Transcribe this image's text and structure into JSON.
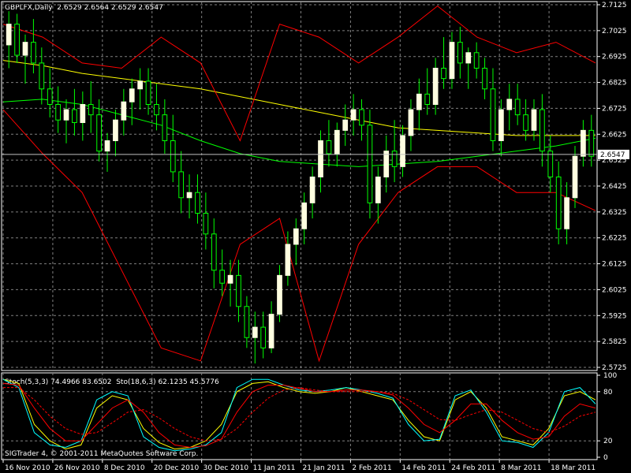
{
  "header": {
    "symbol_line": "GBPLFX,Daily  2.6529 2.6564 2.6529 2.6547",
    "stoch_line": "Stoch(5,3,3) 74.4966 83.6502  Sto(18,6,3) 62.1235 45.5776",
    "copyright": "SIGTrader 4, © 2001-2011 MetaQuotes Software Corp."
  },
  "colors": {
    "background": "#000000",
    "axis": "#ffffff",
    "grid": "#808080",
    "candle_bull": "#ffffe0",
    "candle_bear": "#00ff00",
    "ma_slow": "#ffff00",
    "ma_mid": "#00ff00",
    "bands": "#ff0000",
    "stoch_fast_main": "#ffff00",
    "stoch_slow_main": "#00ffff",
    "stoch_signal": "#ff0000",
    "price_tag_bg": "#ffffff",
    "price_tag_text": "#000000"
  },
  "chart_data": {
    "type": "candlestick",
    "symbol": "GBPLFX",
    "timeframe": "Daily",
    "current_price": "2.6547",
    "ylim": [
      2.5725,
      2.7125
    ],
    "y_tick_labels": [
      "2.7125",
      "2.7025",
      "2.6925",
      "2.6825",
      "2.6725",
      "2.6625",
      "2.6525",
      "2.6425",
      "2.6325",
      "2.6225",
      "2.6125",
      "2.6025",
      "2.5925",
      "2.5825",
      "2.5725"
    ],
    "x_tick_labels": [
      "16 Nov 2010",
      "26 Nov 2010",
      "8 Dec 2010",
      "20 Dec 2010",
      "30 Dec 2010",
      "11 Jan 2011",
      "21 Jan 2011",
      "2 Feb 2011",
      "14 Feb 2011",
      "24 Feb 2011",
      "8 Mar 2011",
      "18 Mar 2011"
    ],
    "candles": [
      [
        2.697,
        2.71,
        2.688,
        2.705
      ],
      [
        2.705,
        2.709,
        2.69,
        2.693
      ],
      [
        2.693,
        2.701,
        2.682,
        2.698
      ],
      [
        2.698,
        2.707,
        2.686,
        2.69
      ],
      [
        2.69,
        2.696,
        2.674,
        2.68
      ],
      [
        2.68,
        2.688,
        2.669,
        2.674
      ],
      [
        2.674,
        2.681,
        2.663,
        2.668
      ],
      [
        2.668,
        2.676,
        2.659,
        2.672
      ],
      [
        2.672,
        2.68,
        2.662,
        2.667
      ],
      [
        2.667,
        2.679,
        2.66,
        2.674
      ],
      [
        2.674,
        2.683,
        2.663,
        2.67
      ],
      [
        2.67,
        2.676,
        2.652,
        2.656
      ],
      [
        2.656,
        2.663,
        2.648,
        2.66
      ],
      [
        2.66,
        2.672,
        2.654,
        2.668
      ],
      [
        2.668,
        2.68,
        2.662,
        2.675
      ],
      [
        2.675,
        2.684,
        2.666,
        2.68
      ],
      [
        2.68,
        2.688,
        2.672,
        2.683
      ],
      [
        2.683,
        2.688,
        2.67,
        2.674
      ],
      [
        2.674,
        2.682,
        2.664,
        2.67
      ],
      [
        2.67,
        2.676,
        2.655,
        2.66
      ],
      [
        2.66,
        2.67,
        2.644,
        2.648
      ],
      [
        2.648,
        2.656,
        2.632,
        2.638
      ],
      [
        2.638,
        2.647,
        2.63,
        2.64
      ],
      [
        2.64,
        2.647,
        2.628,
        2.632
      ],
      [
        2.632,
        2.64,
        2.618,
        2.624
      ],
      [
        2.624,
        2.63,
        2.603,
        2.61
      ],
      [
        2.61,
        2.618,
        2.6,
        2.605
      ],
      [
        2.605,
        2.614,
        2.596,
        2.608
      ],
      [
        2.608,
        2.614,
        2.59,
        2.596
      ],
      [
        2.596,
        2.6,
        2.58,
        2.584
      ],
      [
        2.584,
        2.594,
        2.574,
        2.588
      ],
      [
        2.588,
        2.594,
        2.576,
        2.58
      ],
      [
        2.58,
        2.598,
        2.578,
        2.593
      ],
      [
        2.593,
        2.612,
        2.59,
        2.608
      ],
      [
        2.608,
        2.625,
        2.604,
        2.62
      ],
      [
        2.62,
        2.63,
        2.612,
        2.626
      ],
      [
        2.626,
        2.64,
        2.62,
        2.636
      ],
      [
        2.636,
        2.65,
        2.63,
        2.646
      ],
      [
        2.646,
        2.664,
        2.64,
        2.66
      ],
      [
        2.66,
        2.668,
        2.65,
        2.655
      ],
      [
        2.655,
        2.667,
        2.65,
        2.664
      ],
      [
        2.664,
        2.674,
        2.658,
        2.668
      ],
      [
        2.668,
        2.678,
        2.662,
        2.672
      ],
      [
        2.672,
        2.676,
        2.66,
        2.666
      ],
      [
        2.666,
        2.672,
        2.63,
        2.636
      ],
      [
        2.636,
        2.65,
        2.628,
        2.646
      ],
      [
        2.646,
        2.662,
        2.64,
        2.656
      ],
      [
        2.656,
        2.668,
        2.644,
        2.65
      ],
      [
        2.65,
        2.666,
        2.646,
        2.662
      ],
      [
        2.662,
        2.676,
        2.656,
        2.672
      ],
      [
        2.672,
        2.684,
        2.664,
        2.678
      ],
      [
        2.678,
        2.688,
        2.67,
        2.674
      ],
      [
        2.674,
        2.692,
        2.67,
        2.688
      ],
      [
        2.688,
        2.7,
        2.68,
        2.684
      ],
      [
        2.684,
        2.702,
        2.68,
        2.698
      ],
      [
        2.698,
        2.704,
        2.684,
        2.69
      ],
      [
        2.69,
        2.696,
        2.68,
        2.694
      ],
      [
        2.694,
        2.698,
        2.684,
        2.688
      ],
      [
        2.688,
        2.692,
        2.676,
        2.68
      ],
      [
        2.68,
        2.688,
        2.656,
        2.66
      ],
      [
        2.66,
        2.676,
        2.654,
        2.672
      ],
      [
        2.672,
        2.682,
        2.664,
        2.676
      ],
      [
        2.676,
        2.682,
        2.666,
        2.67
      ],
      [
        2.67,
        2.676,
        2.66,
        2.664
      ],
      [
        2.664,
        2.676,
        2.66,
        2.672
      ],
      [
        2.672,
        2.678,
        2.65,
        2.656
      ],
      [
        2.656,
        2.662,
        2.64,
        2.646
      ],
      [
        2.646,
        2.652,
        2.62,
        2.626
      ],
      [
        2.626,
        2.644,
        2.62,
        2.638
      ],
      [
        2.638,
        2.658,
        2.634,
        2.654
      ],
      [
        2.654,
        2.668,
        2.65,
        2.664
      ],
      [
        2.664,
        2.67,
        2.65,
        2.654
      ]
    ],
    "overlays": [
      {
        "kind": "moving-average-slow",
        "values": [
          2.691,
          2.689,
          2.686,
          2.684,
          2.682,
          2.68,
          2.677,
          2.674,
          2.671,
          2.668,
          2.665,
          2.664,
          2.663,
          2.662,
          2.662,
          2.662
        ]
      },
      {
        "kind": "moving-average-mid",
        "values": [
          2.675,
          2.676,
          2.674,
          2.67,
          2.666,
          2.66,
          2.655,
          2.652,
          2.651,
          2.65,
          2.651,
          2.652,
          2.654,
          2.656,
          2.658,
          2.661
        ]
      },
      {
        "kind": "band-upper",
        "values": [
          2.705,
          2.7,
          2.69,
          2.688,
          2.7,
          2.69,
          2.66,
          2.705,
          2.7,
          2.69,
          2.7,
          2.712,
          2.7,
          2.694,
          2.698,
          2.69
        ]
      },
      {
        "kind": "band-lower",
        "values": [
          2.672,
          2.655,
          2.64,
          2.61,
          2.58,
          2.575,
          2.62,
          2.63,
          2.575,
          2.62,
          2.64,
          2.65,
          2.65,
          2.64,
          2.64,
          2.633
        ]
      }
    ],
    "stochastic": {
      "ylim": [
        0,
        100
      ],
      "y_tick_labels": [
        "100",
        "80",
        "20",
        "0"
      ],
      "series": [
        {
          "values": [
            95,
            90,
            40,
            20,
            10,
            15,
            60,
            75,
            70,
            35,
            18,
            10,
            12,
            20,
            40,
            80,
            90,
            92,
            85,
            80,
            78,
            80,
            85,
            80,
            75,
            70,
            45,
            25,
            20,
            70,
            80,
            60,
            25,
            20,
            15,
            35,
            75,
            80,
            70
          ]
        },
        {
          "values": [
            95,
            85,
            30,
            15,
            12,
            20,
            70,
            80,
            75,
            25,
            12,
            8,
            10,
            15,
            30,
            85,
            95,
            95,
            88,
            82,
            80,
            82,
            85,
            82,
            78,
            72,
            40,
            20,
            22,
            75,
            82,
            55,
            20,
            18,
            12,
            30,
            80,
            85,
            65
          ]
        },
        {
          "values": [
            90,
            88,
            60,
            35,
            20,
            20,
            40,
            60,
            70,
            55,
            30,
            15,
            12,
            14,
            22,
            55,
            80,
            88,
            88,
            84,
            80,
            80,
            82,
            82,
            80,
            76,
            60,
            40,
            30,
            45,
            65,
            65,
            45,
            30,
            22,
            25,
            50,
            65,
            60
          ]
        },
        {
          "values": [
            85,
            85,
            70,
            50,
            35,
            28,
            30,
            42,
            55,
            58,
            48,
            35,
            25,
            20,
            22,
            35,
            55,
            72,
            82,
            85,
            82,
            80,
            80,
            80,
            80,
            78,
            70,
            58,
            46,
            45,
            52,
            58,
            55,
            45,
            35,
            30,
            38,
            50,
            55
          ]
        }
      ]
    }
  }
}
